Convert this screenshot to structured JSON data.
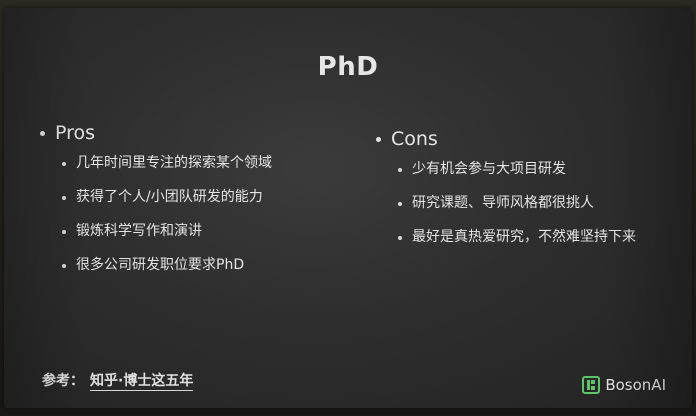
{
  "slide": {
    "title": "PhD",
    "pros": {
      "heading": "Pros",
      "items": [
        "几年时间里专注的探索某个领域",
        "获得了个人/小团队研发的能力",
        "锻炼科学写作和演讲",
        "很多公司研发职位要求PhD"
      ]
    },
    "cons": {
      "heading": "Cons",
      "items": [
        "少有机会参与大项目研发",
        "研究课题、导师风格都很挑人",
        "最好是真热爱研究，不然难坚持下来"
      ]
    },
    "reference": {
      "label": "参考：",
      "link": "知乎·博士这五年"
    },
    "logo": {
      "name": "BosonAI",
      "icon": "boson-logo-icon"
    }
  }
}
